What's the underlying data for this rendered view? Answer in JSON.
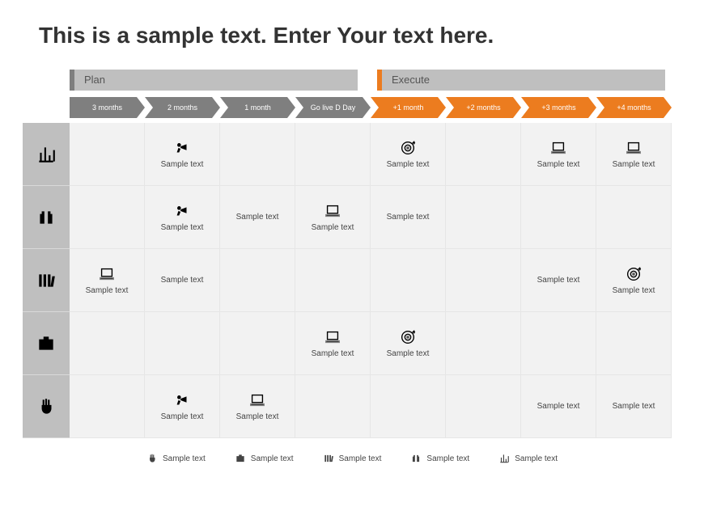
{
  "title": "This is a sample text. Enter Your text here.",
  "phases": {
    "plan": "Plan",
    "execute": "Execute"
  },
  "timeline": [
    "3 months",
    "2 months",
    "1 month",
    "Go live D Day",
    "+1 month",
    "+2 months",
    "+3 months",
    "+4 months"
  ],
  "cellText": "Sample text",
  "legend": [
    "Sample text",
    "Sample text",
    "Sample text",
    "Sample text",
    "Sample text"
  ]
}
